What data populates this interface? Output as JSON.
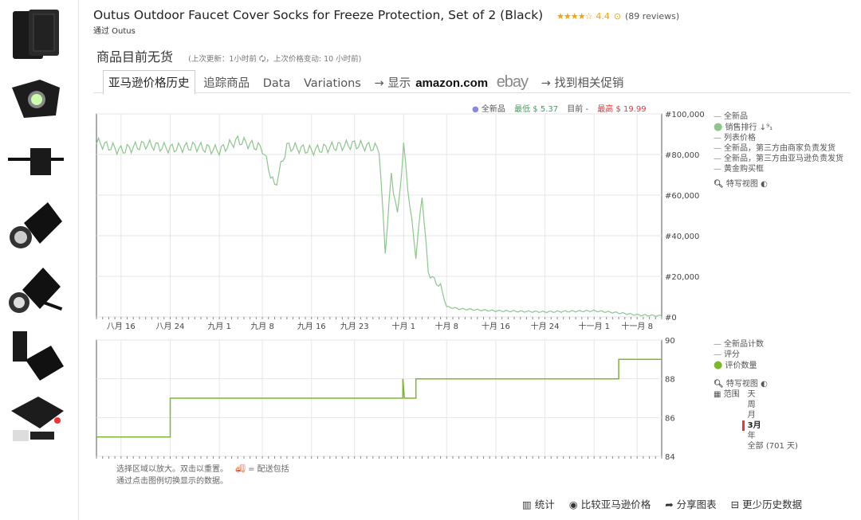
{
  "product": {
    "title": "Outus Outdoor Faucet Cover Socks for Freeze Protection, Set of 2 (Black)",
    "stars": "★★★★☆",
    "rating": "4.4",
    "reviews": "(89 reviews)",
    "byline": "通过 Outus",
    "stock_status": "商品目前无货",
    "update_info": "(上次更新：1小时前 🗘，上次价格变动: 10 小时前)"
  },
  "tabs": {
    "price_history": "亚马逊价格历史",
    "track": "追踪商品",
    "data": "Data",
    "variations": "Variations",
    "show_prefix": "→ 显示",
    "amazon": "amazon.com",
    "ebay": "ebay",
    "find_deals": "→ 找到相关促销"
  },
  "top_info": {
    "new_label": "全新品",
    "lowest": "最低 $ 5.37",
    "current": "目前 -",
    "highest": "最高 $ 19.99"
  },
  "legend_main": {
    "new": "全新品",
    "sales_rank": "销售排行",
    "list_price": "列表价格",
    "new_3p_merchant": "全新品，第三方由商家负责发货",
    "new_3p_amazon": "全新品，第三方由亚马逊负责发货",
    "buy_box": "黄金购买框",
    "zoom_view": "特写视图"
  },
  "legend_lower": {
    "new_count": "全新品计数",
    "rating": "评分",
    "review_count": "评价数量",
    "zoom_view": "特写视图",
    "range_label": "范围",
    "range_options": [
      "天",
      "周",
      "月",
      "3月",
      "年",
      "全部 (701 天)"
    ],
    "range_selected": "3月"
  },
  "footer": {
    "line1": "选择区域以放大。双击以重置。",
    "shipping": "= 配送包括",
    "line2": "通过点击图例切换显示的数据。"
  },
  "bottom_links": {
    "stats": "统计",
    "compare": "比较亚马逊价格",
    "share": "分享图表",
    "less_history": "更少历史数据"
  },
  "colors": {
    "sales_rank": "#8cc68c",
    "review_count": "#7cb82f",
    "new_dot": "#8888dd",
    "lowest": "#3aa655",
    "highest": "#ee3333",
    "rating_star": "#f0a30a"
  },
  "chart_data": [
    {
      "type": "line",
      "title": "",
      "series": [
        {
          "name": "销售排行"
        }
      ],
      "x_ticks": [
        "八月 16",
        "八月 24",
        "九月 1",
        "九月 8",
        "九月 16",
        "九月 23",
        "十月 1",
        "十月 8",
        "十月 16",
        "十月 24",
        "十一月 1",
        "十一月 8"
      ],
      "y_ticks": [
        "#100,000",
        "#80,000",
        "#60,000",
        "#40,000",
        "#20,000",
        "#0"
      ],
      "ylim": [
        0,
        100000
      ],
      "x": [
        "08-12",
        "08-16",
        "08-20",
        "08-24",
        "08-28",
        "09-01",
        "09-04",
        "09-08",
        "09-10",
        "09-12",
        "09-16",
        "09-20",
        "09-23",
        "09-27",
        "09-28",
        "09-29",
        "09-30",
        "10-01",
        "10-02",
        "10-03",
        "10-04",
        "10-05",
        "10-06",
        "10-07",
        "10-08",
        "10-10",
        "10-16",
        "10-24",
        "11-01",
        "11-05",
        "11-08",
        "11-12"
      ],
      "values": [
        86000,
        82000,
        85000,
        83000,
        84000,
        82000,
        87000,
        83000,
        64000,
        84000,
        82000,
        84000,
        85000,
        83000,
        32000,
        70000,
        50000,
        84000,
        55000,
        30000,
        60000,
        22000,
        18000,
        15000,
        5000,
        4000,
        3000,
        2500,
        3000,
        2000,
        1000,
        500
      ],
      "top_labels": {
        "lowest": "最低 $ 5.37",
        "current": "目前 -",
        "highest": "最高 $ 19.99"
      }
    },
    {
      "type": "line",
      "title": "",
      "series": [
        {
          "name": "评价数量"
        }
      ],
      "y_ticks": [
        "90",
        "88",
        "86",
        "84"
      ],
      "ylim": [
        84,
        90
      ],
      "x": [
        "08-12",
        "08-24",
        "08-24",
        "10-01",
        "10-01",
        "10-01",
        "10-02",
        "10-02",
        "10-03",
        "10-03",
        "11-05",
        "11-05",
        "11-12"
      ],
      "values": [
        85,
        85,
        87,
        87,
        88,
        87,
        87,
        87,
        87,
        88,
        88,
        89,
        89
      ]
    }
  ]
}
